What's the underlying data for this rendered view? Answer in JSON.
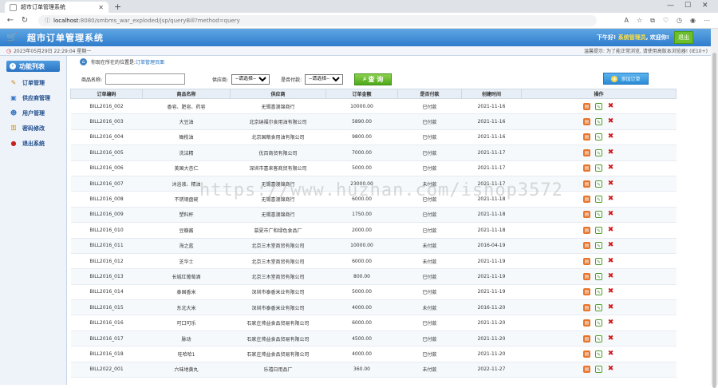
{
  "browser": {
    "tab_title": "超市订单管理系统",
    "tab_close": "✕",
    "new_tab": "+",
    "url_host": "localhost",
    "url_path": ":8080/smbms_war_exploded/jsp/queryBill?method=query"
  },
  "app": {
    "title": "超市订单管理系统",
    "greeting_prefix": "下午好!",
    "user": "系统管理员",
    "greeting_suffix": ", 欢迎你!",
    "logout": "退出"
  },
  "infobar": {
    "datetime": "2023年05月29日 22:29:04 星期一",
    "tip": "温馨提示: 为了能正常浏览, 请使用高版本浏览器! (IE10+)"
  },
  "sidebar": {
    "title": "功能列表",
    "items": [
      {
        "label": "订单管理",
        "icon": "order-icon"
      },
      {
        "label": "供应商管理",
        "icon": "supplier-icon"
      },
      {
        "label": "用户管理",
        "icon": "user-icon"
      },
      {
        "label": "密码修改",
        "icon": "password-icon"
      },
      {
        "label": "退出系统",
        "icon": "exit-icon"
      }
    ]
  },
  "breadcrumb": {
    "prefix": "你现在所在的位置是:",
    "current": "订单管理页面"
  },
  "filter": {
    "product_label": "商品名称:",
    "product_value": "",
    "supplier_label": "供应商:",
    "supplier_selected": "--请选择--",
    "paid_label": "是否付款:",
    "paid_selected": "--请选择--",
    "query_button": "查 询",
    "add_button": "添加订单"
  },
  "table": {
    "headers": [
      "订单编码",
      "商品名称",
      "供应商",
      "订单金额",
      "是否付款",
      "创建时间",
      "操作"
    ],
    "rows": [
      [
        "BILL2016_002",
        "香皂、肥皂、药皂",
        "无锡喜澳锦商行",
        "10000.00",
        "已付款",
        "2021-11-16"
      ],
      [
        "BILL2016_003",
        "大豆油",
        "北京纳福尔食用油有限公司",
        "5890.00",
        "已付款",
        "2021-11-16"
      ],
      [
        "BILL2016_004",
        "橄榄油",
        "北京国粮食用油有限公司",
        "9800.00",
        "已付款",
        "2021-11-16"
      ],
      [
        "BILL2016_005",
        "洗洁精",
        "优百商贸有限公司",
        "7000.00",
        "已付款",
        "2021-11-17"
      ],
      [
        "BILL2016_006",
        "美国大杏仁",
        "深圳市喜来客商贸有限公司",
        "5000.00",
        "已付款",
        "2021-11-17"
      ],
      [
        "BILL2016_007",
        "沐浴液、精油",
        "无锡喜澳锦商行",
        "23000.00",
        "未付款",
        "2021-11-17"
      ],
      [
        "BILL2016_008",
        "不锈钢盘碗",
        "无锡喜澳锦商行",
        "6000.00",
        "已付款",
        "2021-11-18"
      ],
      [
        "BILL2016_009",
        "塑料杯",
        "无锡喜澳锦商行",
        "1750.00",
        "已付款",
        "2021-11-18"
      ],
      [
        "BILL2016_010",
        "豆瓣酱",
        "慕夏市广和绿色食品厂",
        "2000.00",
        "已付款",
        "2021-11-18"
      ],
      [
        "BILL2016_011",
        "海之蓝",
        "北京三木堂商贸有限公司",
        "10000.00",
        "未付款",
        "2016-04-19"
      ],
      [
        "BILL2016_012",
        "芝华士",
        "北京三木堂商贸有限公司",
        "6000.00",
        "未付款",
        "2021-11-19"
      ],
      [
        "BILL2016_013",
        "长城红葡萄酒",
        "北京三木堂商贸有限公司",
        "800.00",
        "已付款",
        "2021-11-19"
      ],
      [
        "BILL2016_014",
        "泰国香米",
        "深圳市泰香米业有限公司",
        "5000.00",
        "已付款",
        "2021-11-19"
      ],
      [
        "BILL2016_015",
        "东北大米",
        "深圳市泰香米业有限公司",
        "4000.00",
        "未付款",
        "2016-11-20"
      ],
      [
        "BILL2016_016",
        "可口可乐",
        "石家庄帅益食品贸易有限公司",
        "6000.00",
        "已付款",
        "2021-11-20"
      ],
      [
        "BILL2016_017",
        "脉动",
        "石家庄帅益食品贸易有限公司",
        "4500.00",
        "已付款",
        "2021-11-20"
      ],
      [
        "BILL2016_018",
        "哇哈哈1",
        "石家庄帅益食品贸易有限公司",
        "4000.00",
        "已付款",
        "2021-11-20"
      ],
      [
        "BILL2022_001",
        "六味地黄丸",
        "乐禧日用品厂",
        "360.00",
        "未付款",
        "2022-11-27"
      ]
    ]
  },
  "watermark": "https://www.huzhan.com/ishop3572",
  "colors": {
    "header_blue": "#2f7ccc",
    "accent_green": "#4ea81a",
    "delete_red": "#d21a1a"
  }
}
